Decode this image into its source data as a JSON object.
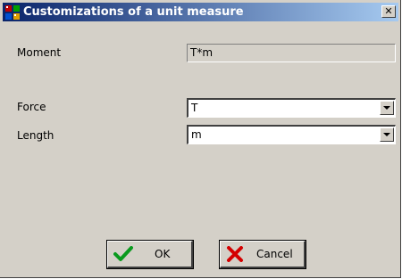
{
  "dialog": {
    "title": "Customizations of a unit measure",
    "close_glyph": "✕"
  },
  "moment": {
    "label": "Moment",
    "value": "T*m"
  },
  "force": {
    "label": "Force",
    "value": "T"
  },
  "length": {
    "label": "Length",
    "value": "m"
  },
  "buttons": {
    "ok_label": "OK",
    "cancel_label": "Cancel"
  },
  "icons": {
    "app": "app-grid-icon",
    "ok": "checkmark-icon",
    "cancel": "cross-icon",
    "dropdown": "chevron-down-icon"
  },
  "colors": {
    "titlebar_start": "#0a246a",
    "titlebar_end": "#a6caf0",
    "face": "#d4d0c8",
    "ok_green": "#0a9a1e",
    "cancel_red": "#d40000"
  }
}
